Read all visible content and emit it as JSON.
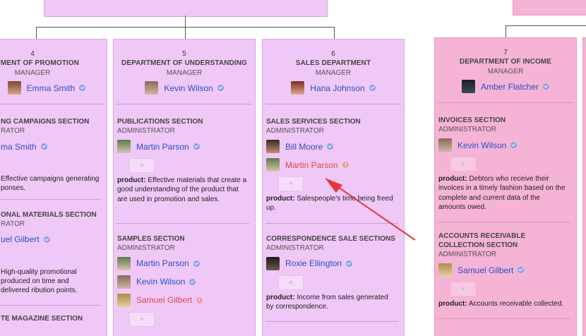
{
  "colors": {
    "purple": "#f0c8f7",
    "pink": "#f5b3d6",
    "link": "#2751c6",
    "alert": "#e04848",
    "arrow": "#e03a3a"
  },
  "columns": [
    {
      "num": "4",
      "title": "ARTMENT OF PROMOTION",
      "role": "MANAGER",
      "manager": {
        "name": "Emma Smith",
        "status": "verified"
      },
      "sections": [
        {
          "title": "NG CAMPAIGNS SECTION",
          "role": "RATOR",
          "people": [
            {
              "name": "ma Smith",
              "status": "verified"
            }
          ],
          "product_label": "",
          "product": "Effective campaigns generating ponses."
        },
        {
          "title": "ONAL MATERIALS SECTION",
          "role": "RATOR",
          "people": [
            {
              "name": "uel Gilbert",
              "status": "verified"
            }
          ],
          "product_label": "",
          "product": "High-quality promotional produced on time and delivered ribution points."
        },
        {
          "title": "TE MAGAZINE SECTION",
          "role": "",
          "people": [],
          "product_label": "",
          "product": ""
        }
      ]
    },
    {
      "num": "5",
      "title": "DEPARTMENT OF UNDERSTANDING",
      "role": "MANAGER",
      "manager": {
        "name": "Kevin Wilson",
        "status": "verified"
      },
      "sections": [
        {
          "title": "PUBLICATIONS SECTION",
          "role": "ADMINISTRATOR",
          "people": [
            {
              "name": "Martin Parson",
              "status": "verified"
            }
          ],
          "product_label": "product:",
          "product": "Effective materials that create a good understanding of the product that are used in promotion and sales."
        },
        {
          "title": "SAMPLES SECTION",
          "role": "ADMINISTRATOR",
          "people": [
            {
              "name": "Martin Parson",
              "status": "verified"
            },
            {
              "name": "Kevin Wilson",
              "status": "verified"
            },
            {
              "name": "Samuel Gilbert",
              "status": "alert"
            }
          ],
          "product_label": "",
          "product": ""
        }
      ]
    },
    {
      "num": "6",
      "title": "SALES DEPARTMENT",
      "role": "MANAGER",
      "manager": {
        "name": "Hana Johnson",
        "status": "verified"
      },
      "sections": [
        {
          "title": "SALES SERVICES SECTION",
          "role": "ADMINISTRATOR",
          "people": [
            {
              "name": "Bill Moore",
              "status": "verified"
            },
            {
              "name": "Martin Parson",
              "status": "alert"
            }
          ],
          "product_label": "product:",
          "product": "Salespeople's time being freed up."
        },
        {
          "title": "CORRESPONDENCE SALE SECTIONS",
          "role": "ADMINISTRATOR",
          "people": [
            {
              "name": "Roxie Ellington",
              "status": "verified"
            }
          ],
          "product_label": "product:",
          "product": "Income from sales generated by correspondence."
        }
      ]
    },
    {
      "num": "7",
      "title": "DEPARTMENT OF INCOME",
      "role": "MANAGER",
      "manager": {
        "name": "Amber Flatcher",
        "status": "verified"
      },
      "sections": [
        {
          "title": "INVOICES SECTION",
          "role": "ADMINISTRATOR",
          "people": [
            {
              "name": "Kevin Wilson",
              "status": "verified"
            }
          ],
          "product_label": "product:",
          "product": "Debtors who receive their invoices in a timely fashion based on the complete and current data of the amounts owed."
        },
        {
          "title": "ACCOUNTS RECEIVABLE COLLECTION SECTION",
          "role": "ADMINISTRATOR",
          "people": [
            {
              "name": "Samuel Gilbert",
              "status": "verified"
            }
          ],
          "product_label": "product:",
          "product": "Accounts receivable collected."
        }
      ]
    }
  ],
  "add_label": "+"
}
